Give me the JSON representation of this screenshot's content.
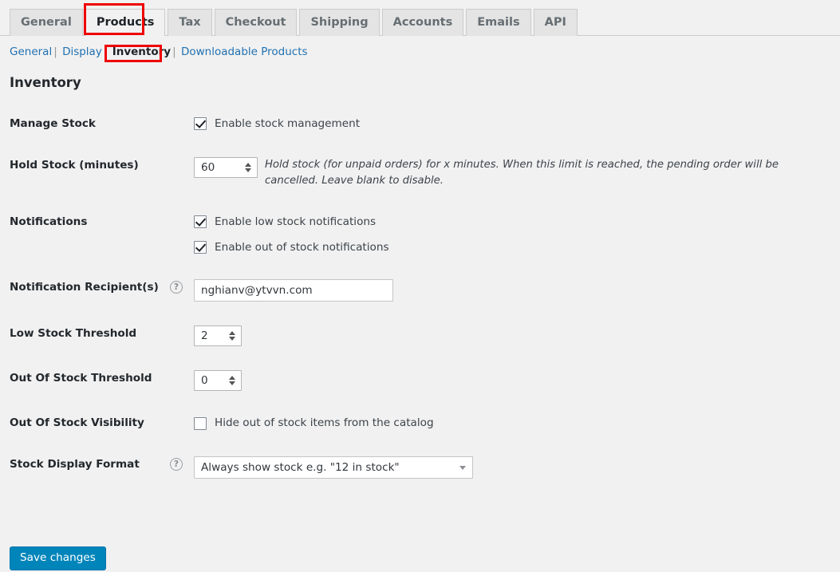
{
  "tabs": [
    {
      "label": "General",
      "active": false
    },
    {
      "label": "Products",
      "active": true
    },
    {
      "label": "Tax",
      "active": false
    },
    {
      "label": "Checkout",
      "active": false
    },
    {
      "label": "Shipping",
      "active": false
    },
    {
      "label": "Accounts",
      "active": false
    },
    {
      "label": "Emails",
      "active": false
    },
    {
      "label": "API",
      "active": false
    }
  ],
  "subnav": {
    "items": [
      {
        "label": "General",
        "current": false
      },
      {
        "label": "Display",
        "current": false
      },
      {
        "label": "Inventory",
        "current": true
      },
      {
        "label": "Downloadable Products",
        "current": false
      }
    ],
    "separator": "|"
  },
  "section": {
    "title": "Inventory"
  },
  "fields": {
    "manage_stock": {
      "label": "Manage Stock",
      "checkbox_label": "Enable stock management",
      "checked": true
    },
    "hold_stock": {
      "label": "Hold Stock (minutes)",
      "value": "60",
      "description": "Hold stock (for unpaid orders) for x minutes. When this limit is reached, the pending order will be cancelled. Leave blank to disable."
    },
    "notifications": {
      "label": "Notifications",
      "low_stock_label": "Enable low stock notifications",
      "low_stock_checked": true,
      "out_of_stock_label": "Enable out of stock notifications",
      "out_of_stock_checked": true
    },
    "notification_recipients": {
      "label": "Notification Recipient(s)",
      "value": "nghianv@ytvvn.com",
      "help_icon": "question-mark-icon"
    },
    "low_stock_threshold": {
      "label": "Low Stock Threshold",
      "value": "2"
    },
    "out_of_stock_threshold": {
      "label": "Out Of Stock Threshold",
      "value": "0"
    },
    "out_of_stock_visibility": {
      "label": "Out Of Stock Visibility",
      "checkbox_label": "Hide out of stock items from the catalog",
      "checked": false
    },
    "stock_display_format": {
      "label": "Stock Display Format",
      "value": "Always show stock e.g. \"12 in stock\"",
      "help_icon": "question-mark-icon"
    }
  },
  "submit": {
    "label": "Save changes"
  },
  "annotations": {
    "products_tab": "highlight-rectangle",
    "inventory_subnav": "highlight-rectangle",
    "color": "#ee0000"
  },
  "icons": {
    "help": "?",
    "spinner_up": "spinner-up-icon",
    "spinner_down": "spinner-down-icon",
    "select_arrow": "chevron-down-icon"
  },
  "colors": {
    "primary_button": "#0085ba",
    "link": "#2271b1",
    "page_background": "#f1f1f1",
    "annotation": "#ee0000"
  }
}
